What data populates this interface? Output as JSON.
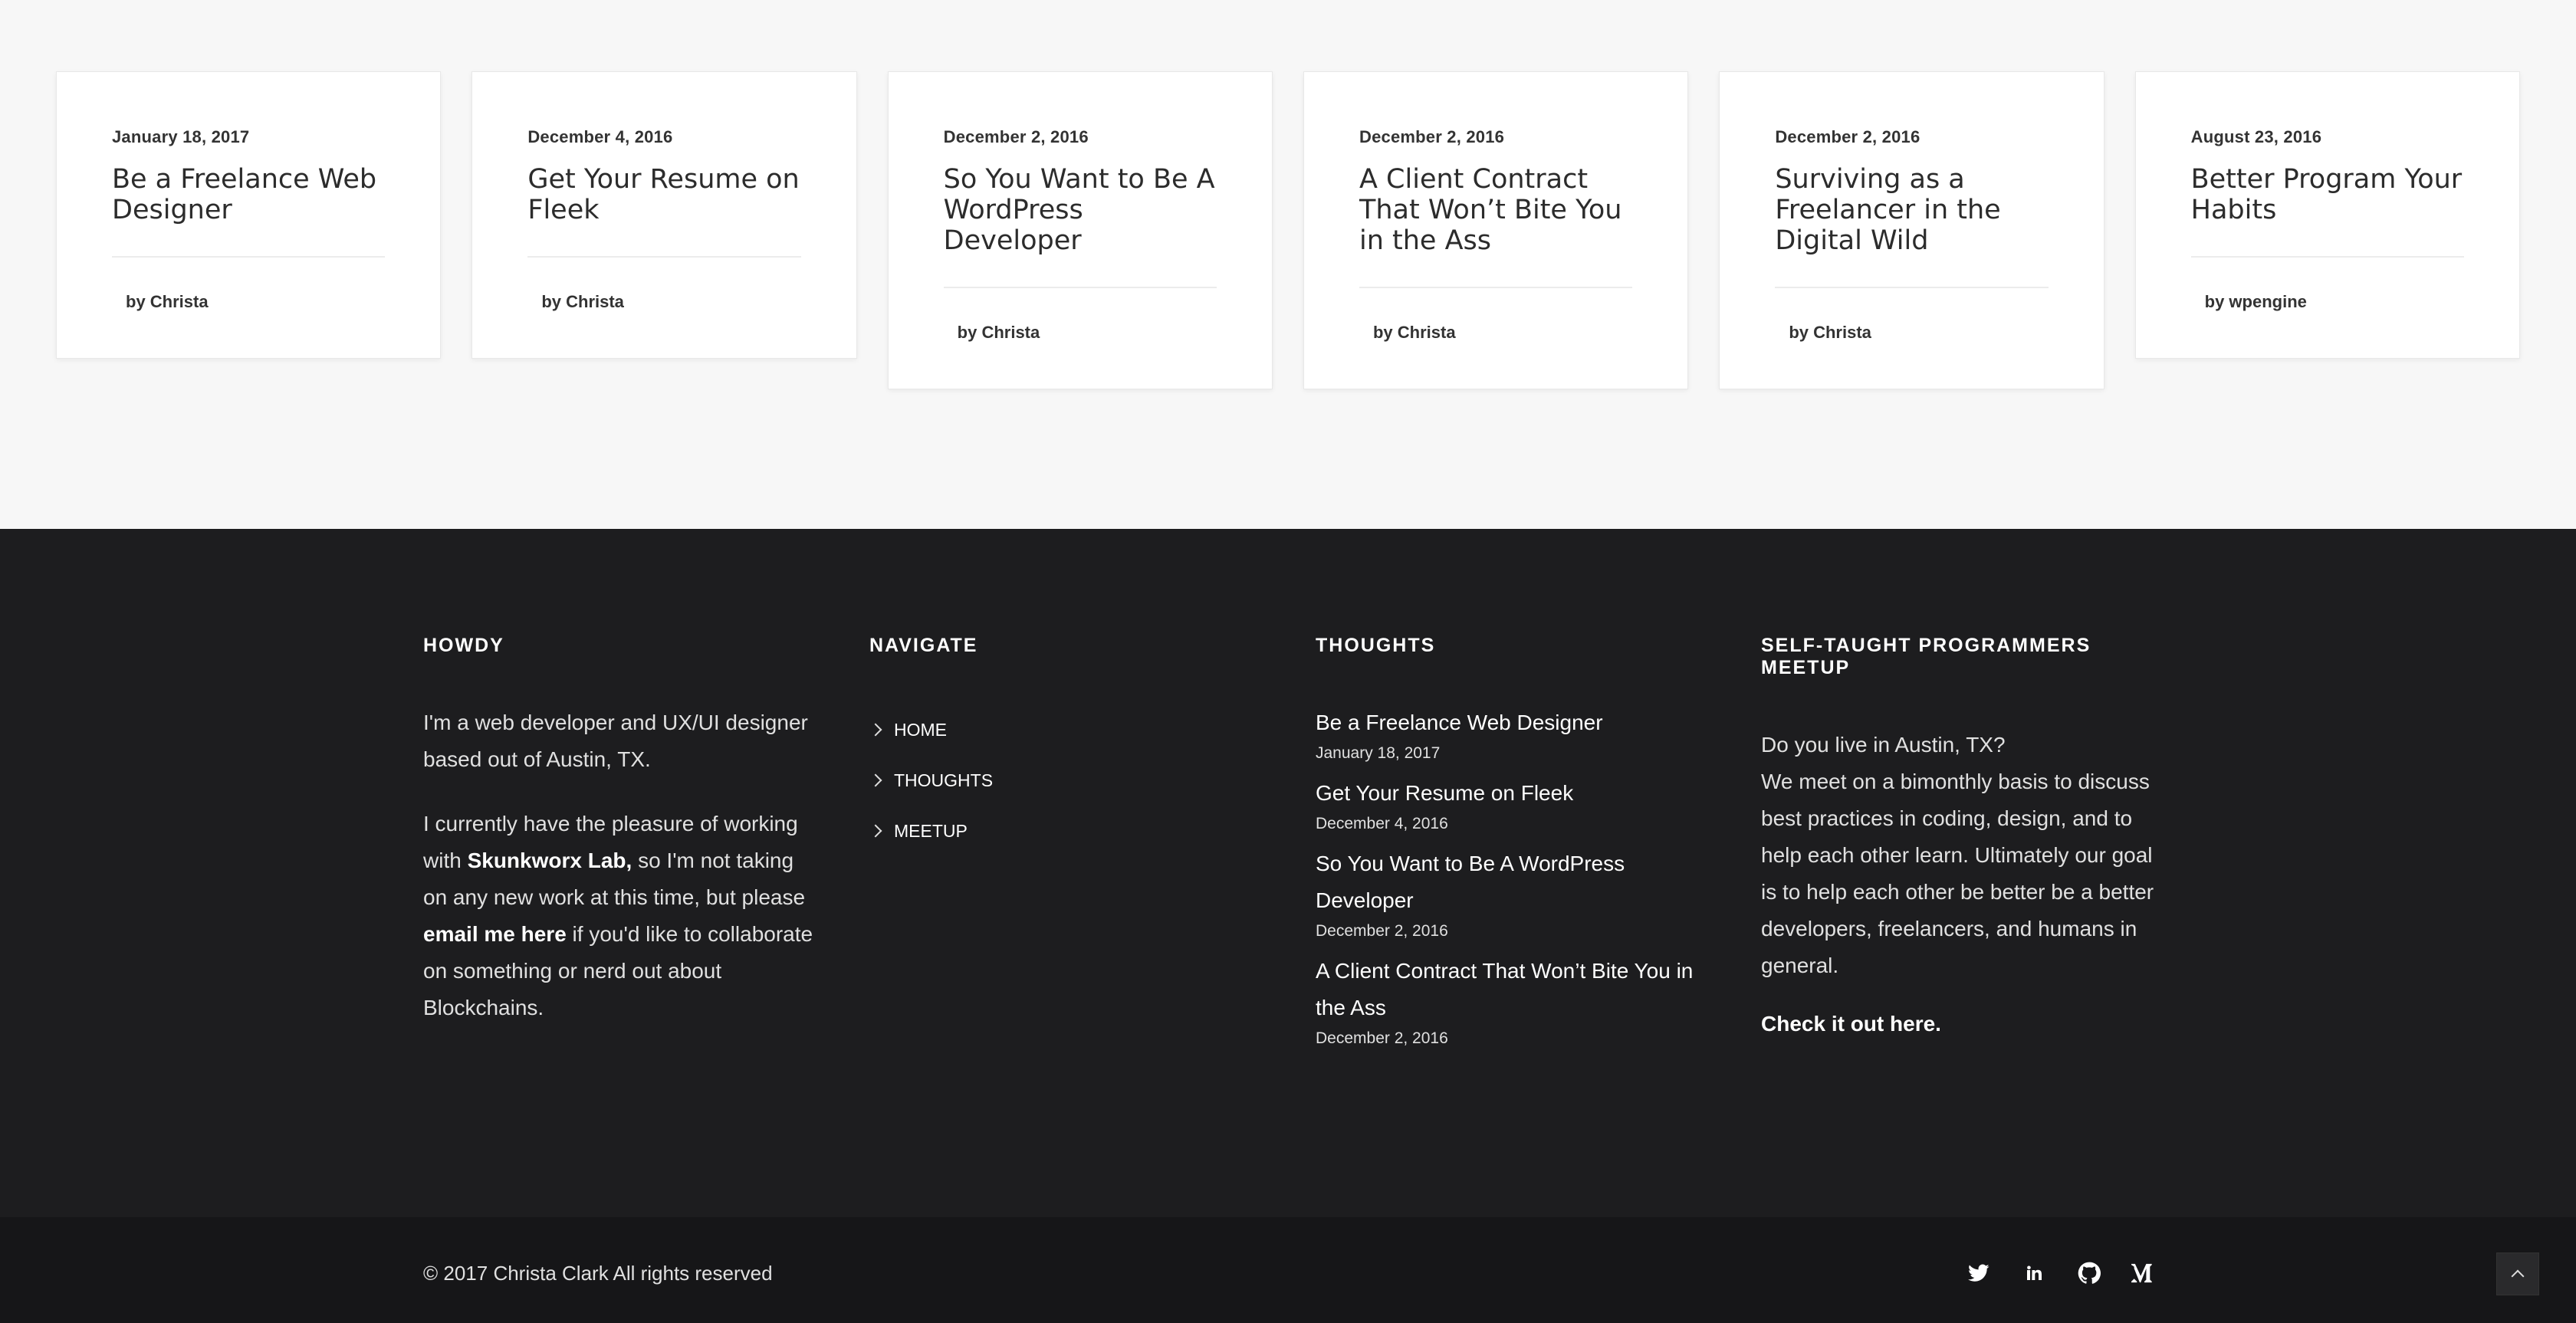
{
  "cards": [
    {
      "date": "January 18, 2017",
      "title": "Be a Freelance Web Designer",
      "author": "by Christa"
    },
    {
      "date": "December 4, 2016",
      "title": "Get Your Resume on Fleek",
      "author": "by Christa"
    },
    {
      "date": "December 2, 2016",
      "title": "So You Want to Be A WordPress Developer",
      "author": "by Christa"
    },
    {
      "date": "December 2, 2016",
      "title": "A Client Contract That Won’t Bite You in the Ass",
      "author": "by Christa"
    },
    {
      "date": "December 2, 2016",
      "title": "Surviving as a Freelancer in the Digital Wild",
      "author": "by Christa"
    },
    {
      "date": "August 23, 2016",
      "title": "Better Program Your Habits",
      "author": "by wpengine"
    }
  ],
  "footer": {
    "howdy": {
      "heading": "HOWDY",
      "p1": "I'm a web developer and UX/UI designer based out of Austin, TX.",
      "p2_a": "I currently have the pleasure of working with ",
      "p2_link1": "Skunkworx Lab,",
      "p2_b": " so I'm not taking on any new work at this time, but please ",
      "p2_link2": "email me here",
      "p2_c": " if you'd like to collaborate on something or nerd out about Blockchains."
    },
    "navigate": {
      "heading": "NAVIGATE",
      "items": [
        "HOME",
        "THOUGHTS",
        "MEETUP"
      ]
    },
    "thoughts": {
      "heading": "THOUGHTS",
      "items": [
        {
          "title": "Be a Freelance Web Designer",
          "date": "January 18, 2017"
        },
        {
          "title": "Get Your Resume on Fleek",
          "date": "December 4, 2016"
        },
        {
          "title": "So You Want to Be A WordPress Developer",
          "date": "December 2, 2016"
        },
        {
          "title": "A Client Contract That Won’t Bite You in the Ass",
          "date": "December 2, 2016"
        }
      ]
    },
    "meetup": {
      "heading": "SELF-TAUGHT PROGRAMMERS MEETUP",
      "text_line1": "Do you live in Austin, TX?",
      "text_body": "We meet on a bimonthly basis to discuss best practices in coding, design, and to help each other learn. Ultimately our goal is to help each other be better be a better developers, freelancers, and humans in general.",
      "link": "Check it out here."
    }
  },
  "bottombar": {
    "copyright": "© 2017 Christa Clark All rights reserved",
    "socials": [
      "twitter-icon",
      "linkedin-icon",
      "github-icon",
      "medium-icon"
    ]
  }
}
